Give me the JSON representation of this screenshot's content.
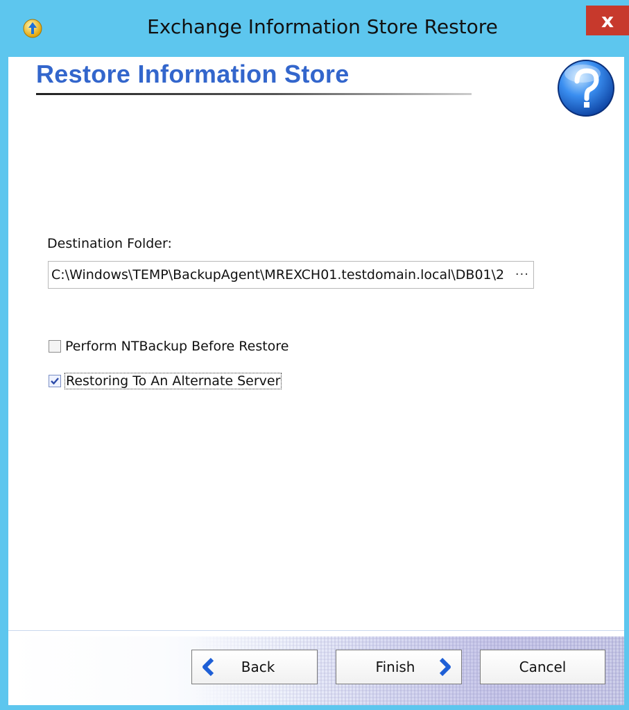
{
  "window": {
    "title": "Exchange Information Store Restore",
    "close_label": "x"
  },
  "header": {
    "title": "Restore Information Store"
  },
  "form": {
    "destination_label": "Destination Folder:",
    "destination_value": "C:\\Windows\\TEMP\\BackupAgent\\MREXCH01.testdomain.local\\DB01\\2",
    "browse_label": "···",
    "options": [
      {
        "label": "Perform NTBackup Before Restore",
        "checked": false
      },
      {
        "label": "Restoring To An Alternate Server",
        "checked": true
      }
    ]
  },
  "buttons": {
    "back": "Back",
    "finish": "Finish",
    "cancel": "Cancel"
  },
  "colors": {
    "titlebar": "#5dc6ee",
    "close": "#c7392c",
    "header_title": "#3366cc",
    "arrow_blue": "#1e5fd6"
  }
}
